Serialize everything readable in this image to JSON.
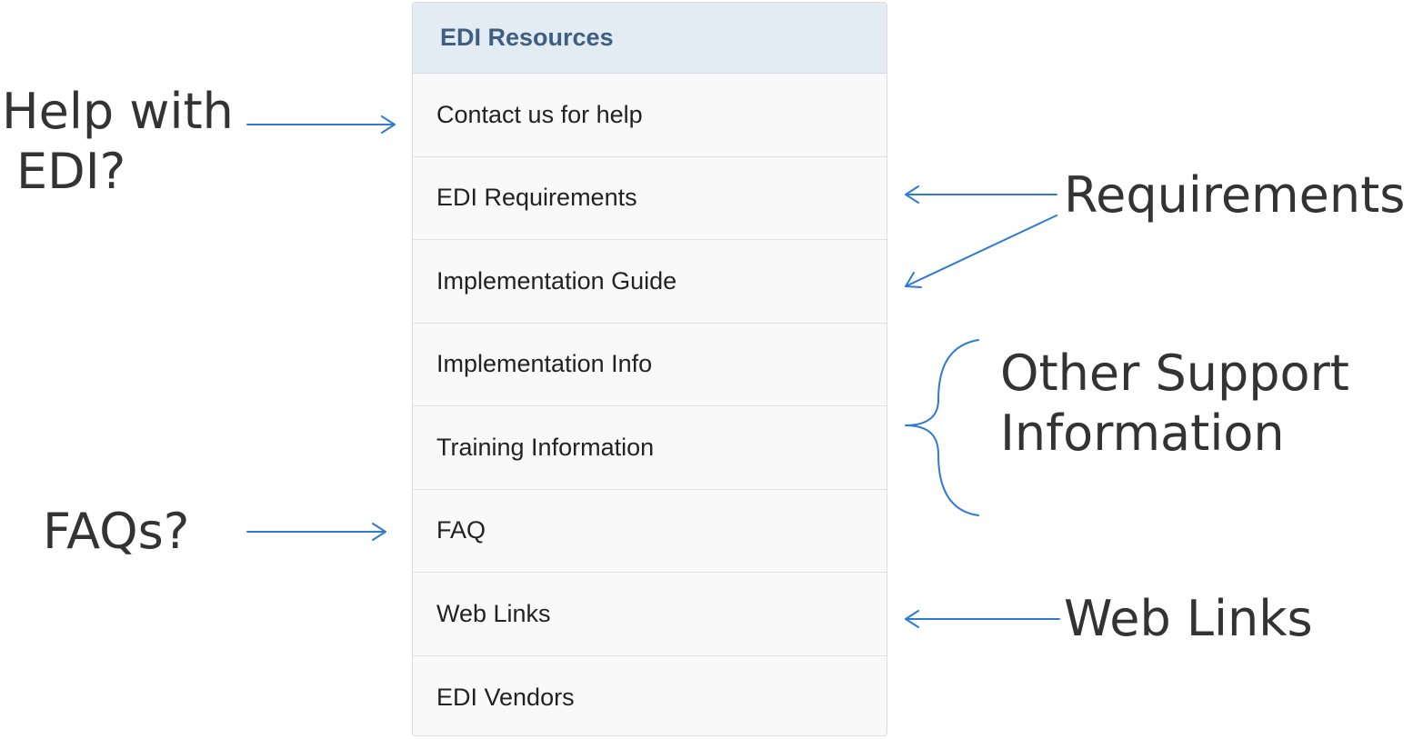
{
  "panel": {
    "title": "EDI Resources",
    "items": [
      {
        "label": "Contact us for help"
      },
      {
        "label": "EDI Requirements"
      },
      {
        "label": "Implementation Guide"
      },
      {
        "label": "Implementation Info"
      },
      {
        "label": "Training Information"
      },
      {
        "label": "FAQ"
      },
      {
        "label": "Web Links"
      },
      {
        "label": "EDI Vendors"
      }
    ]
  },
  "annotations": {
    "help_line1": "Help with",
    "help_line2": "EDI?",
    "faqs": "FAQs?",
    "requirements": "Requirements",
    "other_line1": "Other Support",
    "other_line2": "Information",
    "web_links": "Web Links",
    "arrow_color": "#2f7ad6"
  }
}
